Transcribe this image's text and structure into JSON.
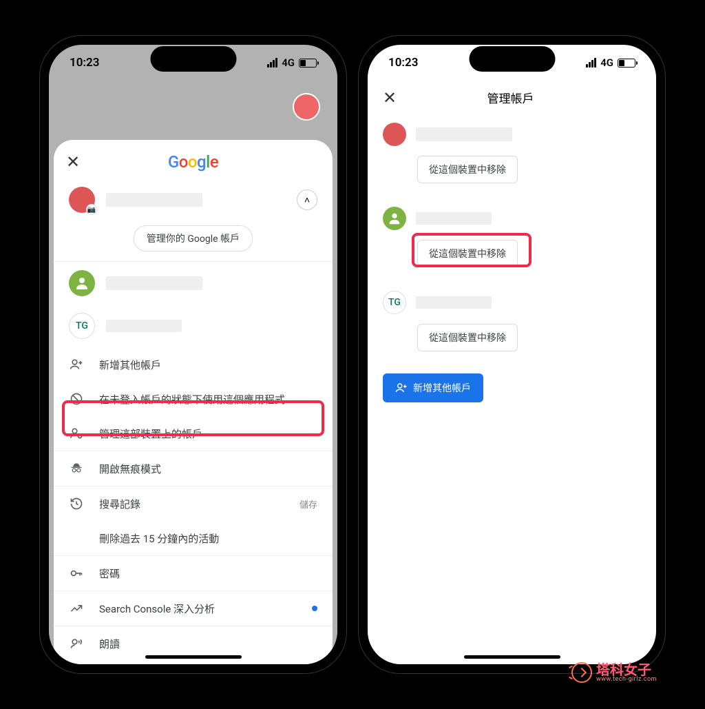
{
  "statusbar": {
    "time": "10:23",
    "network": "4G"
  },
  "left": {
    "logo_letters": [
      "G",
      "o",
      "o",
      "g",
      "l",
      "e"
    ],
    "manage_account_button": "管理你的 Google 帳戶",
    "account2_initials": "TG",
    "menu": {
      "add_account": "新增其他帳戶",
      "use_without_login": "在未登入帳戶的狀態下使用這個應用程式",
      "manage_accounts": "管理這部裝置上的帳戶",
      "incognito": "開啟無痕模式",
      "search_history": "搜尋記錄",
      "search_history_trailing": "儲存",
      "delete_activity": "刪除過去 15 分鐘內的活動",
      "passwords": "密碼",
      "search_console": "Search Console 深入分析",
      "read_aloud": "朗讀"
    }
  },
  "right": {
    "title": "管理帳戶",
    "remove_label": "從這個裝置中移除",
    "add_account_label": "新增其他帳戶",
    "account2_initials": "TG"
  },
  "watermark": {
    "text": "塔科女子",
    "sub": "www.tech-girlz.com"
  }
}
